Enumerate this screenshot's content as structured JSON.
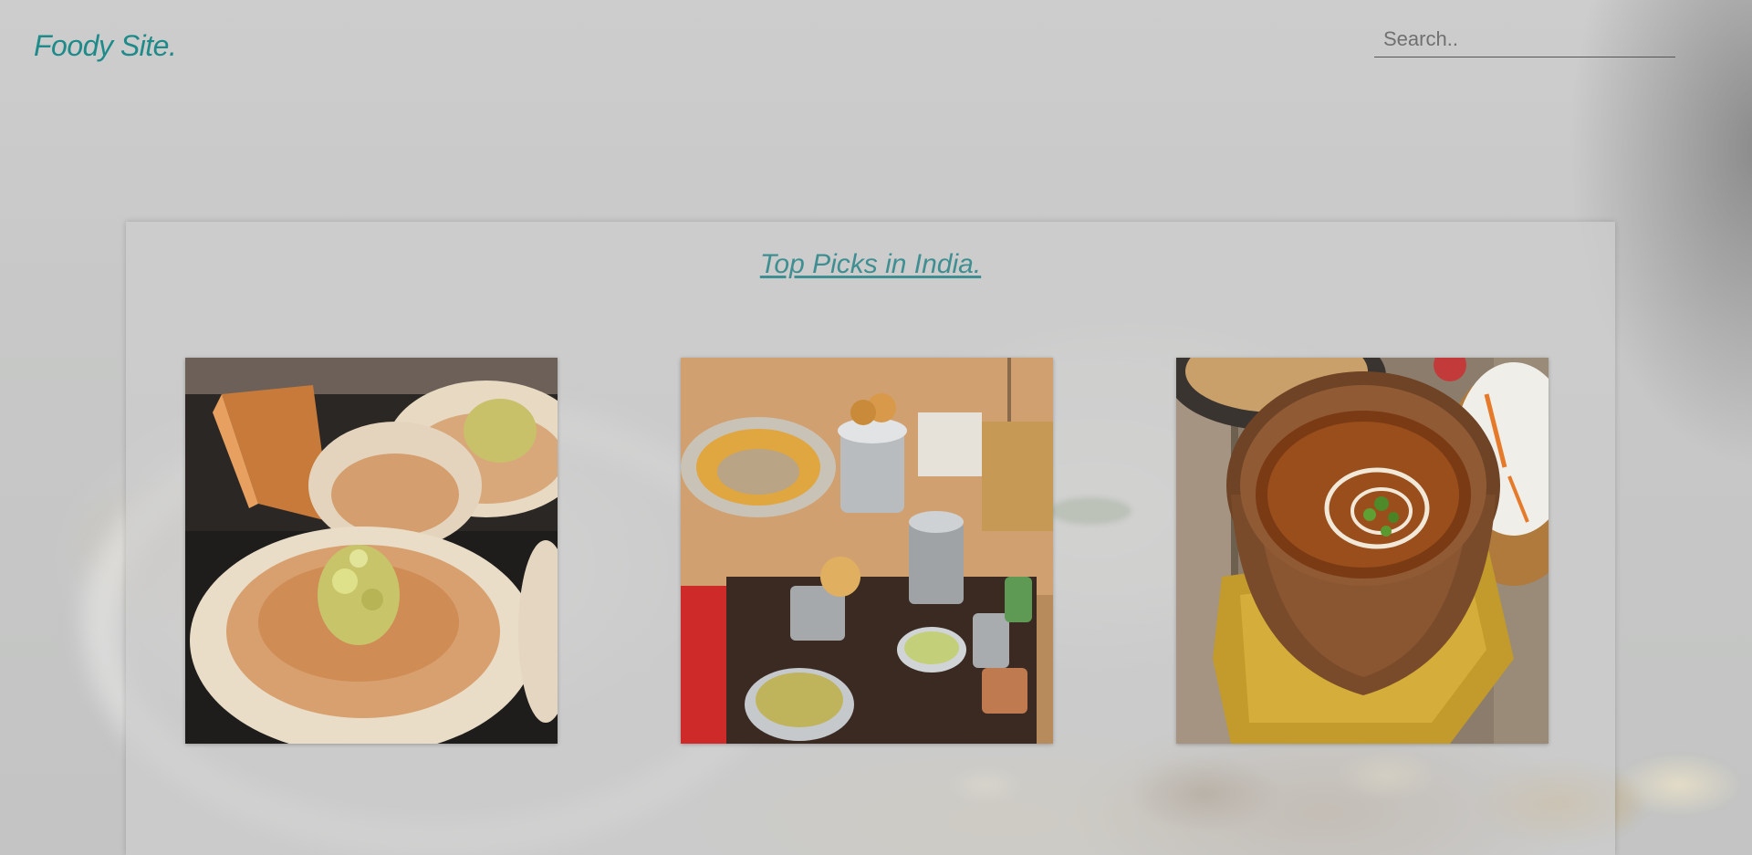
{
  "header": {
    "logo": "Foody Site.",
    "search": {
      "placeholder": "Search..",
      "value": ""
    }
  },
  "main": {
    "title": "Top Picks in India.",
    "cards": [
      {
        "image": "dosa-photo"
      },
      {
        "image": "street-food-cart-photo"
      },
      {
        "image": "dal-makhani-bowl-photo"
      }
    ]
  },
  "colors": {
    "brand": "#1f8a8a",
    "title": "#3f8f92",
    "background": "#c9c9c9",
    "panel": "#cdcdcd"
  }
}
